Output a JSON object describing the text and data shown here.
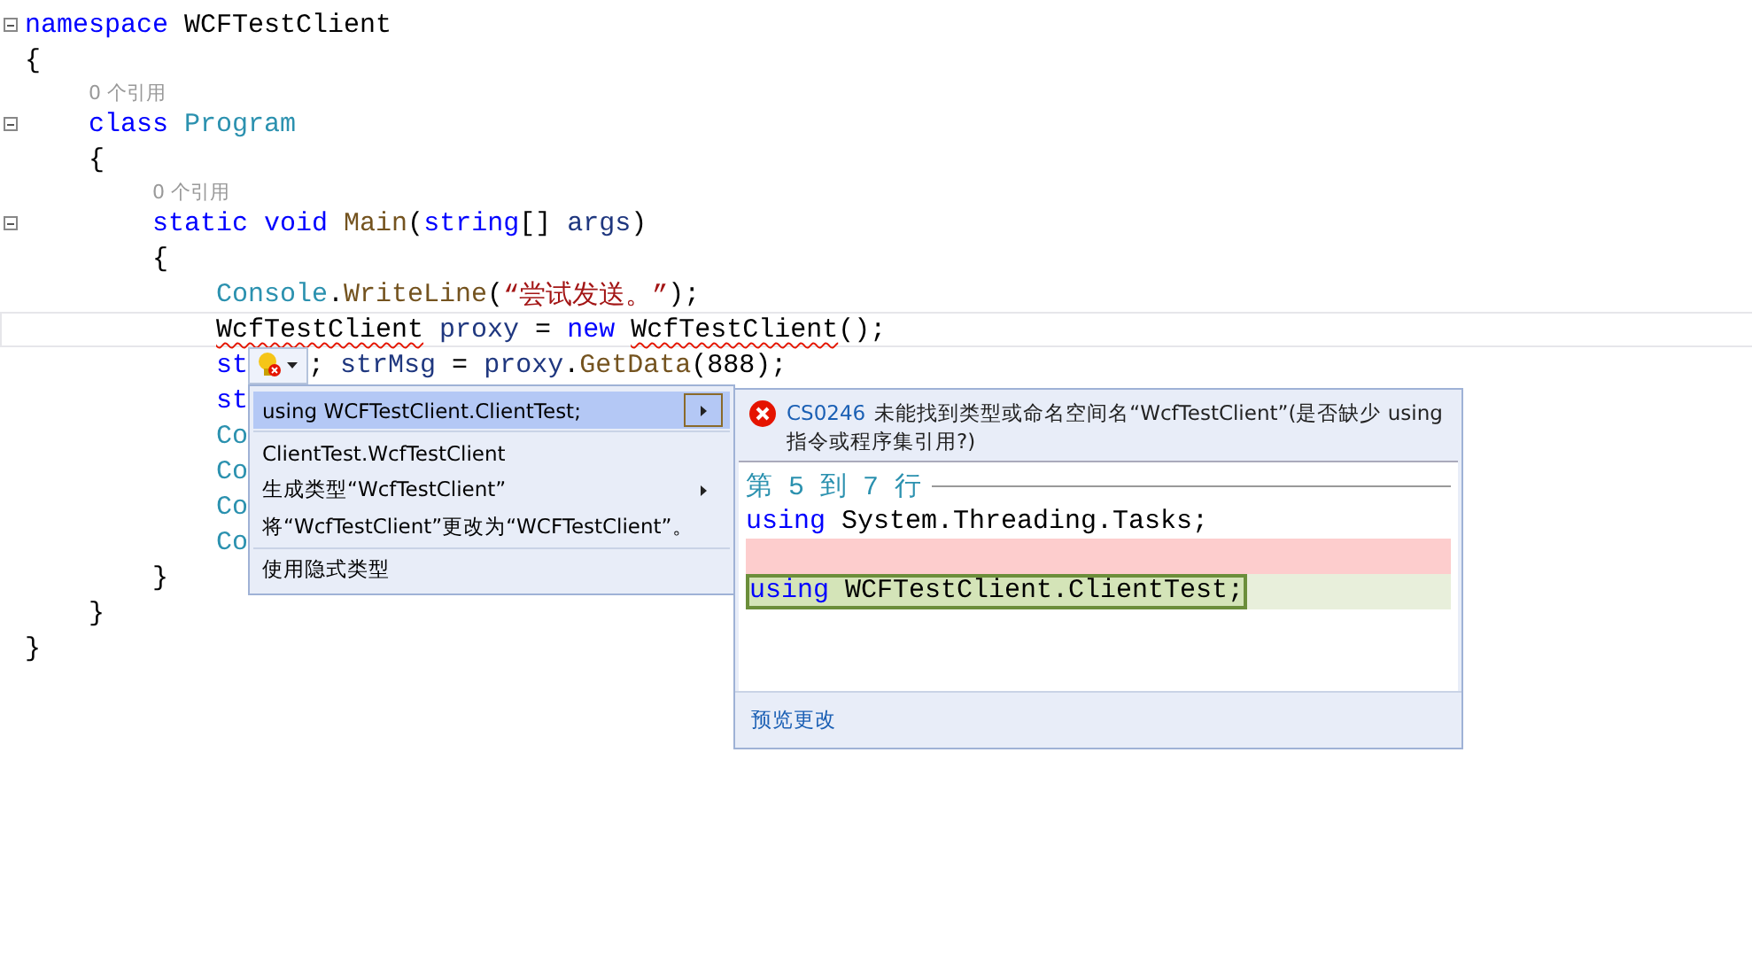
{
  "editor": {
    "lines": [
      {
        "kind": "code",
        "fold": true,
        "tokens": [
          {
            "kind": "keyword",
            "text": "namespace "
          },
          {
            "kind": "plain",
            "text": "WCFTestClient"
          }
        ]
      },
      {
        "kind": "code",
        "tokens": [
          {
            "kind": "plain",
            "text": "{"
          }
        ],
        "children": [
          {
            "kind": "codelens",
            "text": "0 个引用"
          },
          {
            "kind": "code",
            "fold": true,
            "tokens": [
              {
                "kind": "keyword",
                "text": "class "
              },
              {
                "kind": "type",
                "text": "Program"
              }
            ]
          },
          {
            "kind": "code",
            "tokens": [
              {
                "kind": "plain",
                "text": "{"
              }
            ],
            "children": [
              {
                "kind": "codelens",
                "text": "0 个引用"
              },
              {
                "kind": "code",
                "fold": true,
                "tokens": [
                  {
                    "kind": "keyword",
                    "text": "static void "
                  },
                  {
                    "kind": "method",
                    "text": "Main"
                  },
                  {
                    "kind": "plain",
                    "text": "("
                  },
                  {
                    "kind": "keyword",
                    "text": "string"
                  },
                  {
                    "kind": "plain",
                    "text": "[] "
                  },
                  {
                    "kind": "local",
                    "text": "args"
                  },
                  {
                    "kind": "plain",
                    "text": ")"
                  }
                ]
              },
              {
                "kind": "code",
                "tokens": [
                  {
                    "kind": "plain",
                    "text": "{"
                  }
                ],
                "children": [
                  {
                    "kind": "code",
                    "tokens": [
                      {
                        "kind": "type",
                        "text": "Console"
                      },
                      {
                        "kind": "plain",
                        "text": "."
                      },
                      {
                        "kind": "method",
                        "text": "WriteLine"
                      },
                      {
                        "kind": "plain",
                        "text": "("
                      },
                      {
                        "kind": "string",
                        "text": "“尝试发送。”"
                      },
                      {
                        "kind": "plain",
                        "text": ");"
                      }
                    ]
                  },
                  {
                    "kind": "code",
                    "current": true,
                    "tokens": [
                      {
                        "kind": "plain",
                        "text": "WcfTestClient",
                        "error": true
                      },
                      {
                        "kind": "local",
                        "text": " proxy"
                      },
                      {
                        "kind": "plain",
                        "text": " = "
                      },
                      {
                        "kind": "keyword",
                        "text": "new "
                      },
                      {
                        "kind": "plain",
                        "text": "WcfTestClient",
                        "error": true
                      },
                      {
                        "kind": "plain",
                        "text": "();"
                      }
                    ]
                  },
                  {
                    "kind": "code",
                    "tokens": [
                      {
                        "kind": "keyword",
                        "text": "st"
                      },
                      {
                        "kind": "lightbulb"
                      },
                      {
                        "kind": "plain",
                        "text": ";"
                      },
                      {
                        "kind": "local",
                        "text": " strMsg"
                      },
                      {
                        "kind": "plain",
                        "text": " = "
                      },
                      {
                        "kind": "local",
                        "text": "proxy"
                      },
                      {
                        "kind": "plain",
                        "text": "."
                      },
                      {
                        "kind": "method",
                        "text": "GetData"
                      },
                      {
                        "kind": "plain",
                        "text": "(888);"
                      }
                    ]
                  },
                  {
                    "kind": "code",
                    "tokens": [
                      {
                        "kind": "keyword",
                        "text": "st"
                      }
                    ]
                  },
                  {
                    "kind": "code",
                    "tokens": [
                      {
                        "kind": "type",
                        "text": "Co"
                      }
                    ]
                  },
                  {
                    "kind": "code",
                    "tokens": [
                      {
                        "kind": "type",
                        "text": "Co"
                      }
                    ]
                  },
                  {
                    "kind": "code",
                    "tokens": [
                      {
                        "kind": "type",
                        "text": "Co"
                      }
                    ]
                  },
                  {
                    "kind": "code",
                    "tokens": [
                      {
                        "kind": "type",
                        "text": "Co"
                      }
                    ]
                  }
                ]
              },
              {
                "kind": "code",
                "tokens": [
                  {
                    "kind": "plain",
                    "text": "}"
                  }
                ]
              }
            ]
          },
          {
            "kind": "code",
            "tokens": [
              {
                "kind": "plain",
                "text": "}"
              }
            ]
          }
        ]
      },
      {
        "kind": "code",
        "tokens": [
          {
            "kind": "plain",
            "text": "}"
          }
        ]
      }
    ]
  },
  "quick_actions_menu": {
    "groups": [
      [
        {
          "label": "using WCFTestClient.ClientTest;",
          "selected": true,
          "submenu": true
        }
      ],
      [
        {
          "label": "ClientTest.WcfTestClient",
          "selected": false,
          "submenu": false
        },
        {
          "label": "生成类型“WcfTestClient”",
          "selected": false,
          "submenu": true
        },
        {
          "label": "将“WcfTestClient”更改为“WCFTestClient”。",
          "selected": false,
          "submenu": false
        }
      ],
      [
        {
          "label": "使用隐式类型",
          "selected": false,
          "submenu": false
        }
      ]
    ]
  },
  "preview": {
    "error_code": "CS0246",
    "message": "未能找到类型或命名空间名“WcfTestClient”(是否缺少 using 指令或程序集引用?)",
    "range": "第 5 到 7 行",
    "lines": [
      {
        "kind": "context",
        "tokens": [
          {
            "kind": "keyword",
            "text": "using"
          },
          {
            "kind": "plain",
            "text": " System.Threading.Tasks;"
          }
        ]
      },
      {
        "kind": "removed"
      },
      {
        "kind": "added",
        "tokens": [
          {
            "kind": "keyword",
            "text": "using"
          },
          {
            "kind": "plain",
            "text": " WCFTestClient.ClientTest;"
          }
        ]
      }
    ],
    "link": "预览更改"
  }
}
